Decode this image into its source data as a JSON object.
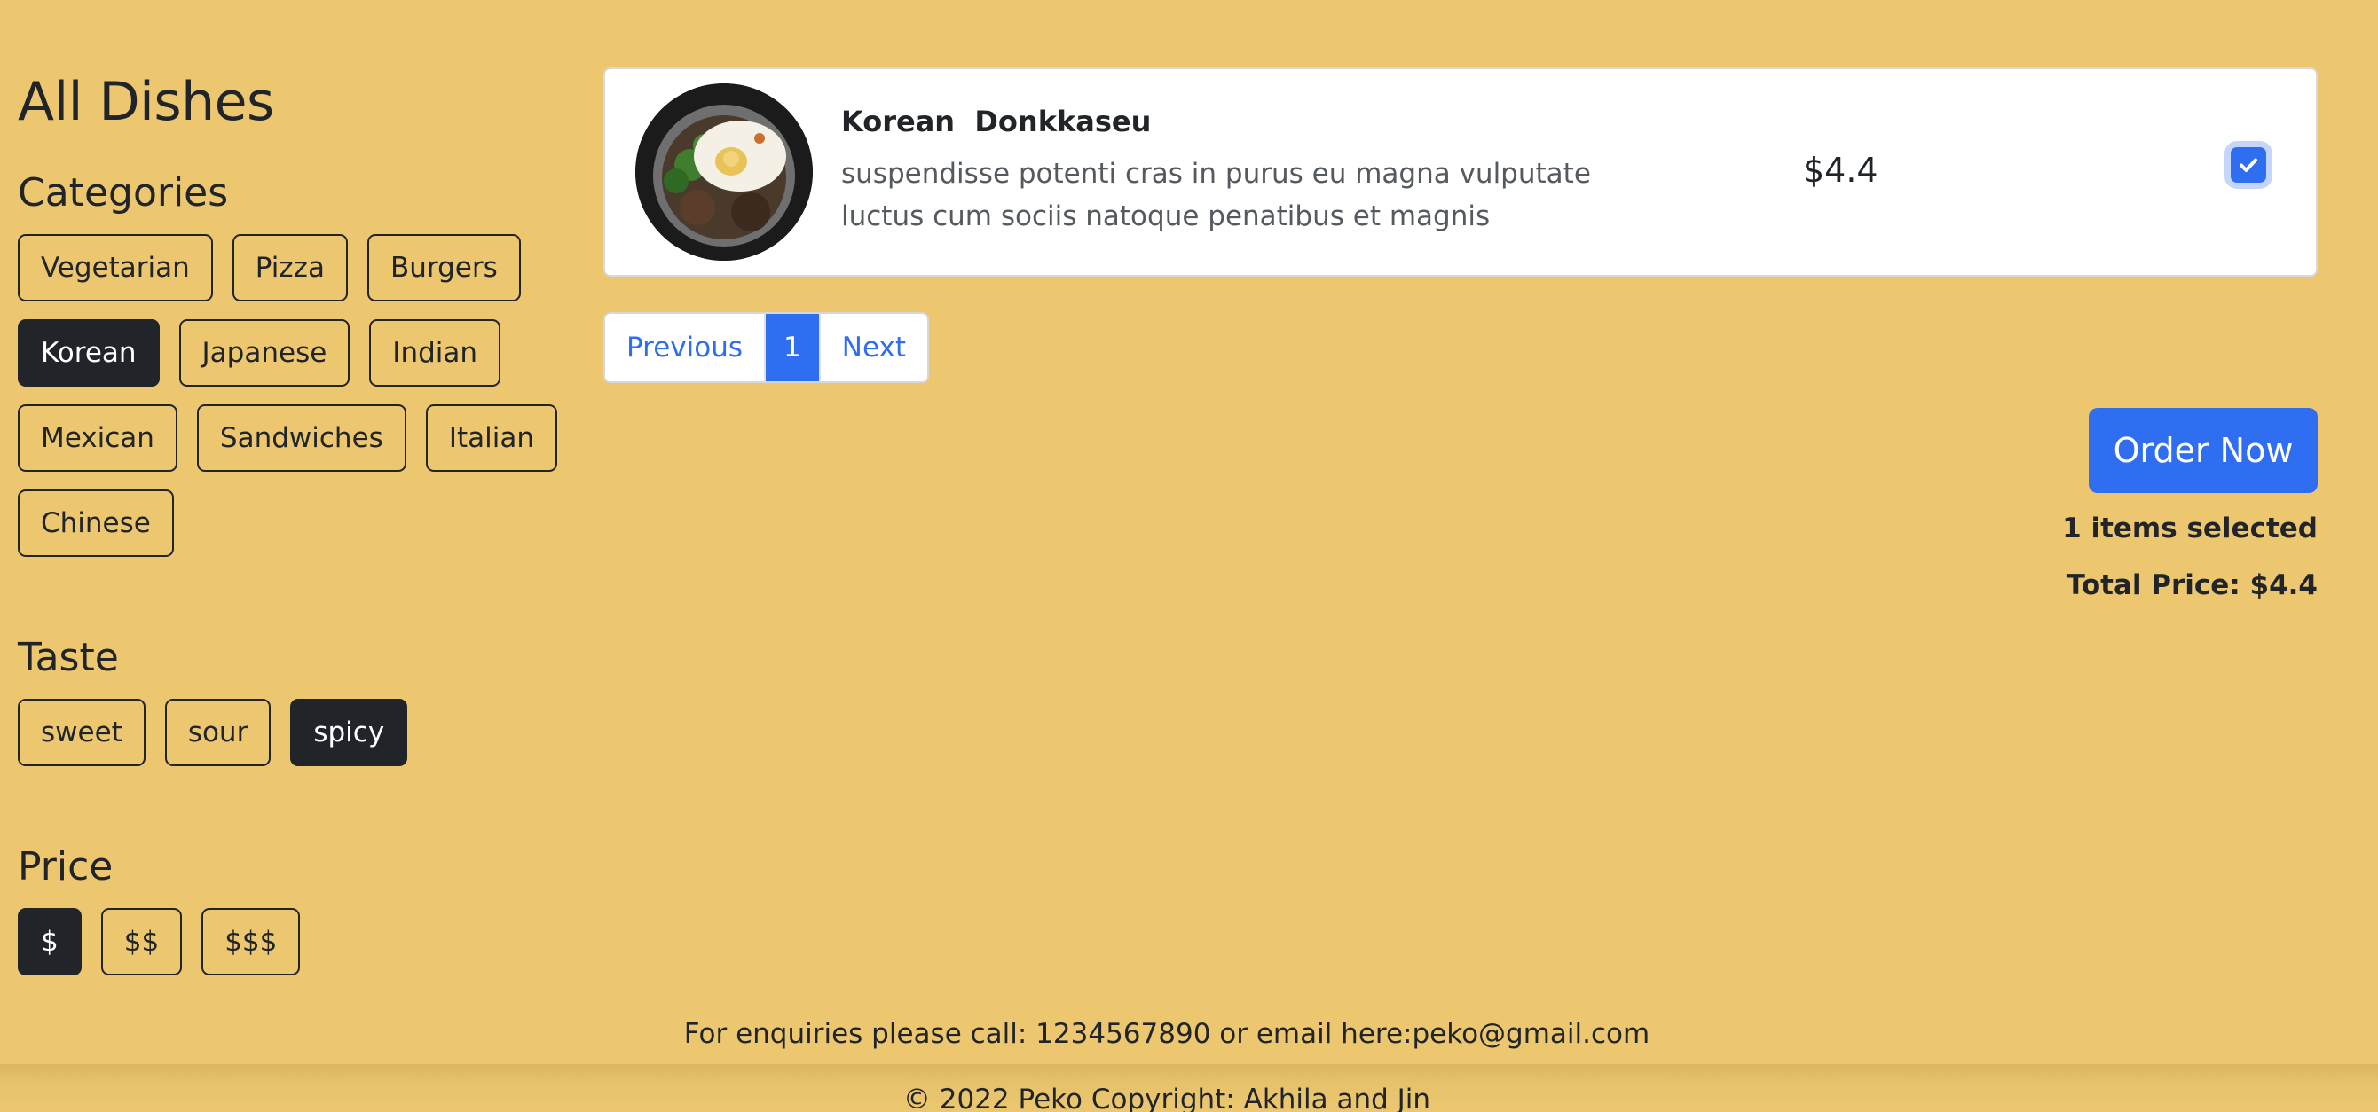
{
  "sidebar": {
    "title": "All Dishes",
    "categories_title": "Categories",
    "categories": [
      {
        "label": "Vegetarian",
        "active": false
      },
      {
        "label": "Pizza",
        "active": false
      },
      {
        "label": "Burgers",
        "active": false
      },
      {
        "label": "Korean",
        "active": true
      },
      {
        "label": "Japanese",
        "active": false
      },
      {
        "label": "Indian",
        "active": false
      },
      {
        "label": "Mexican",
        "active": false
      },
      {
        "label": "Sandwiches",
        "active": false
      },
      {
        "label": "Italian",
        "active": false
      },
      {
        "label": "Chinese",
        "active": false
      }
    ],
    "taste_title": "Taste",
    "tastes": [
      {
        "label": "sweet",
        "active": false
      },
      {
        "label": "sour",
        "active": false
      },
      {
        "label": "spicy",
        "active": true
      }
    ],
    "price_title": "Price",
    "prices": [
      {
        "label": "$",
        "active": true
      },
      {
        "label": "$$",
        "active": false
      },
      {
        "label": "$$$",
        "active": false
      }
    ]
  },
  "dish": {
    "name": "Korean  Donkkaseu",
    "description": "suspendisse potenti cras in purus eu magna vulputate luctus cum sociis natoque penatibus et magnis",
    "price": "$4.4",
    "selected": true,
    "image_icon": "food-bowl-photo"
  },
  "pagination": {
    "previous": "Previous",
    "current": "1",
    "next": "Next"
  },
  "order": {
    "button": "Order Now",
    "items_selected": "1 items selected",
    "total_price": "Total Price: $4.4"
  },
  "footer": {
    "contact": "For enquiries please call: 1234567890 or email here:peko@gmail.com",
    "copyright": "© 2022 Peko Copyright: Akhila and Jin"
  },
  "colors": {
    "background": "#ecc76f",
    "accent": "#2f6ef0",
    "active_chip": "#212529"
  }
}
